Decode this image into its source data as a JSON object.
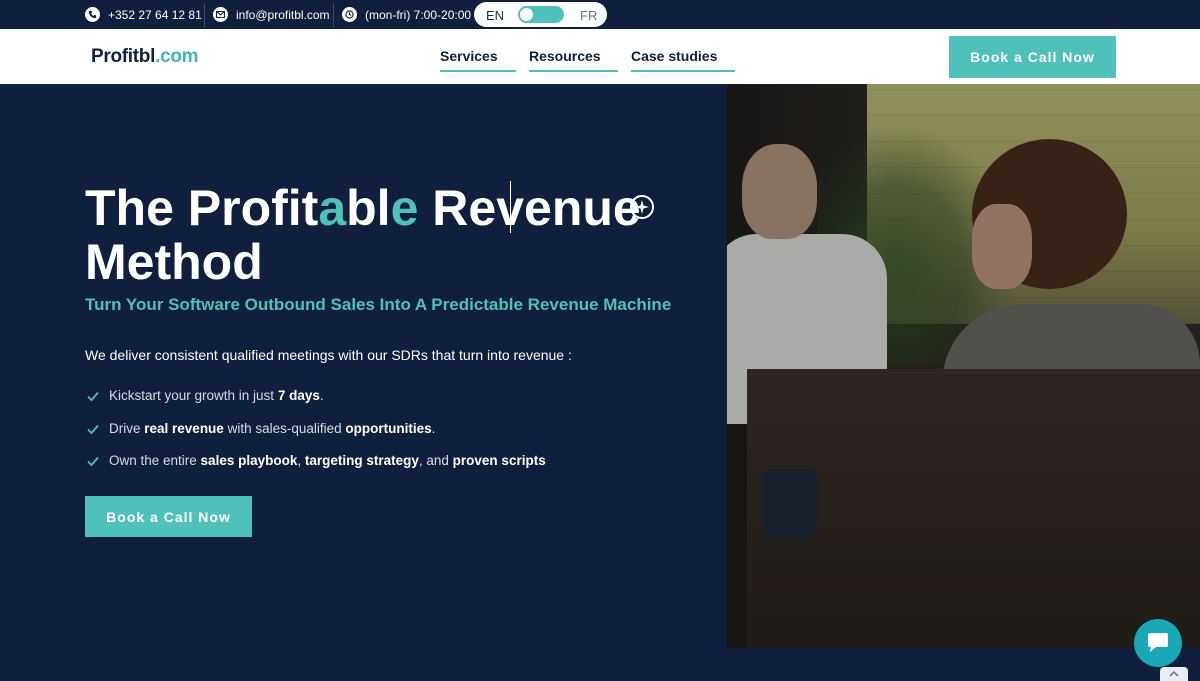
{
  "topbar": {
    "phone": "+352 27 64 12 81",
    "email": "info@profitbl.com",
    "hours": "(mon-fri) 7:00-20:00",
    "lang_en": "EN",
    "lang_fr": "FR"
  },
  "header": {
    "logo_main": "Profitbl",
    "logo_domain": ".com",
    "nav": {
      "services": "Services",
      "resources": "Resources",
      "case_studies": "Case studies"
    },
    "cta": "Book a Call Now"
  },
  "hero": {
    "title_part1": "The Profit",
    "title_teal1": "a",
    "title_part2": "bl",
    "title_teal2": "e",
    "title_part3": " Revenue",
    "title_line2": "Method",
    "subtitle": "Turn Your Software Outbound Sales Into A Predictable Revenue Machine",
    "intro": "We deliver consistent qualified meetings with our SDRs that turn into revenue :",
    "feature1": {
      "t1": "Kickstart your growth in just ",
      "b1": "7 days",
      "t2": "."
    },
    "feature2": {
      "t1": "Drive ",
      "b1": "real revenue",
      "t2": " with sales-qualified ",
      "b2": "opportunities",
      "t3": "."
    },
    "feature3": {
      "t1": "Own the entire ",
      "b1": "sales playbook",
      "t2": ", ",
      "b2": "targeting strategy",
      "t3": ", and ",
      "b3": "proven scripts"
    },
    "cta": "Book a Call Now"
  },
  "colors": {
    "navy": "#0f1f3d",
    "teal": "#50c0ba",
    "chat": "#1aa8b8"
  }
}
